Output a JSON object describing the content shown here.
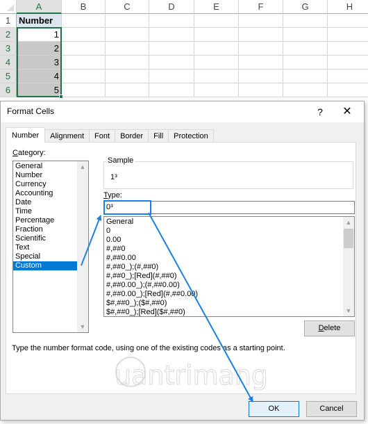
{
  "sheet": {
    "columns": [
      "A",
      "B",
      "C",
      "D",
      "E",
      "F",
      "G",
      "H"
    ],
    "rows": [
      "1",
      "2",
      "3",
      "4",
      "5",
      "6"
    ],
    "header_cell": "Number",
    "values": [
      "1",
      "2",
      "3",
      "4",
      "5"
    ],
    "selection_color": "#217346"
  },
  "dialog": {
    "title": "Format Cells",
    "help_label": "?",
    "close_label": "✕",
    "tabs": [
      "Number",
      "Alignment",
      "Font",
      "Border",
      "Fill",
      "Protection"
    ],
    "active_tab": "Number",
    "category_label_first": "C",
    "category_label_rest": "ategory:",
    "categories": [
      "General",
      "Number",
      "Currency",
      "Accounting",
      "Date",
      "Time",
      "Percentage",
      "Fraction",
      "Scientific",
      "Text",
      "Special",
      "Custom"
    ],
    "selected_category": "Custom",
    "sample_label": "Sample",
    "sample_value": "1³",
    "type_label_first": "T",
    "type_label_rest": "ype:",
    "type_value": "0³",
    "format_codes": [
      "General",
      "0",
      "0.00",
      "#,##0",
      "#,##0.00",
      "#,##0_);(#,##0)",
      "#,##0_);[Red](#,##0)",
      "#,##0.00_);(#,##0.00)",
      "#,##0.00_);[Red](#,##0.00)",
      "$#,##0_);($#,##0)",
      "$#,##0_);[Red]($#,##0)"
    ],
    "delete_label_first": "D",
    "delete_label_rest": "elete",
    "hint": "Type the number format code, using one of the existing codes as a starting point.",
    "ok_label": "OK",
    "cancel_label": "Cancel",
    "accent_color": "#0078d7",
    "annotation_arrow_color": "#1a7fe6"
  },
  "watermark": {
    "text": "uantrimang"
  }
}
